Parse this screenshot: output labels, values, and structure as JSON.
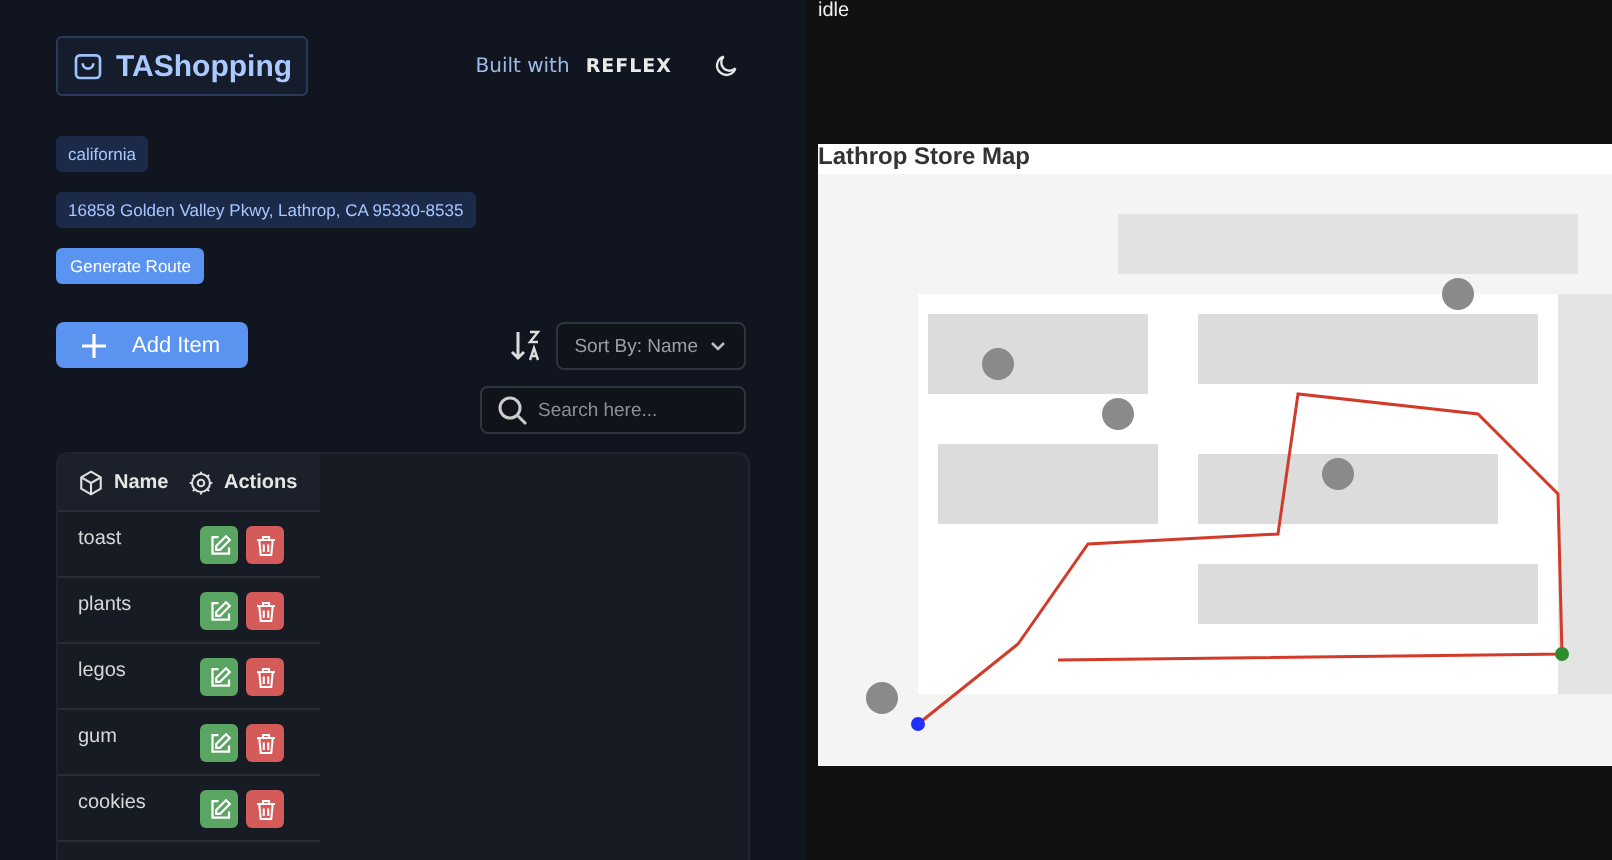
{
  "header": {
    "logo": "TAShopping",
    "built_with": "Built with",
    "brand": "REFLEX"
  },
  "location": "california",
  "address": "16858 Golden Valley Pkwy, Lathrop, CA 95330-8535",
  "route_button": "Generate Route",
  "add_button": "Add Item",
  "sort": {
    "value": "Sort By: Name"
  },
  "search": {
    "placeholder": "Search here..."
  },
  "table": {
    "columns": [
      "Name",
      "Actions"
    ],
    "rows": [
      {
        "name": "toast"
      },
      {
        "name": "plants"
      },
      {
        "name": "legos"
      },
      {
        "name": "gum"
      },
      {
        "name": "cookies"
      }
    ]
  },
  "status": "idle",
  "map": {
    "title": "Lathrop Store Map"
  }
}
